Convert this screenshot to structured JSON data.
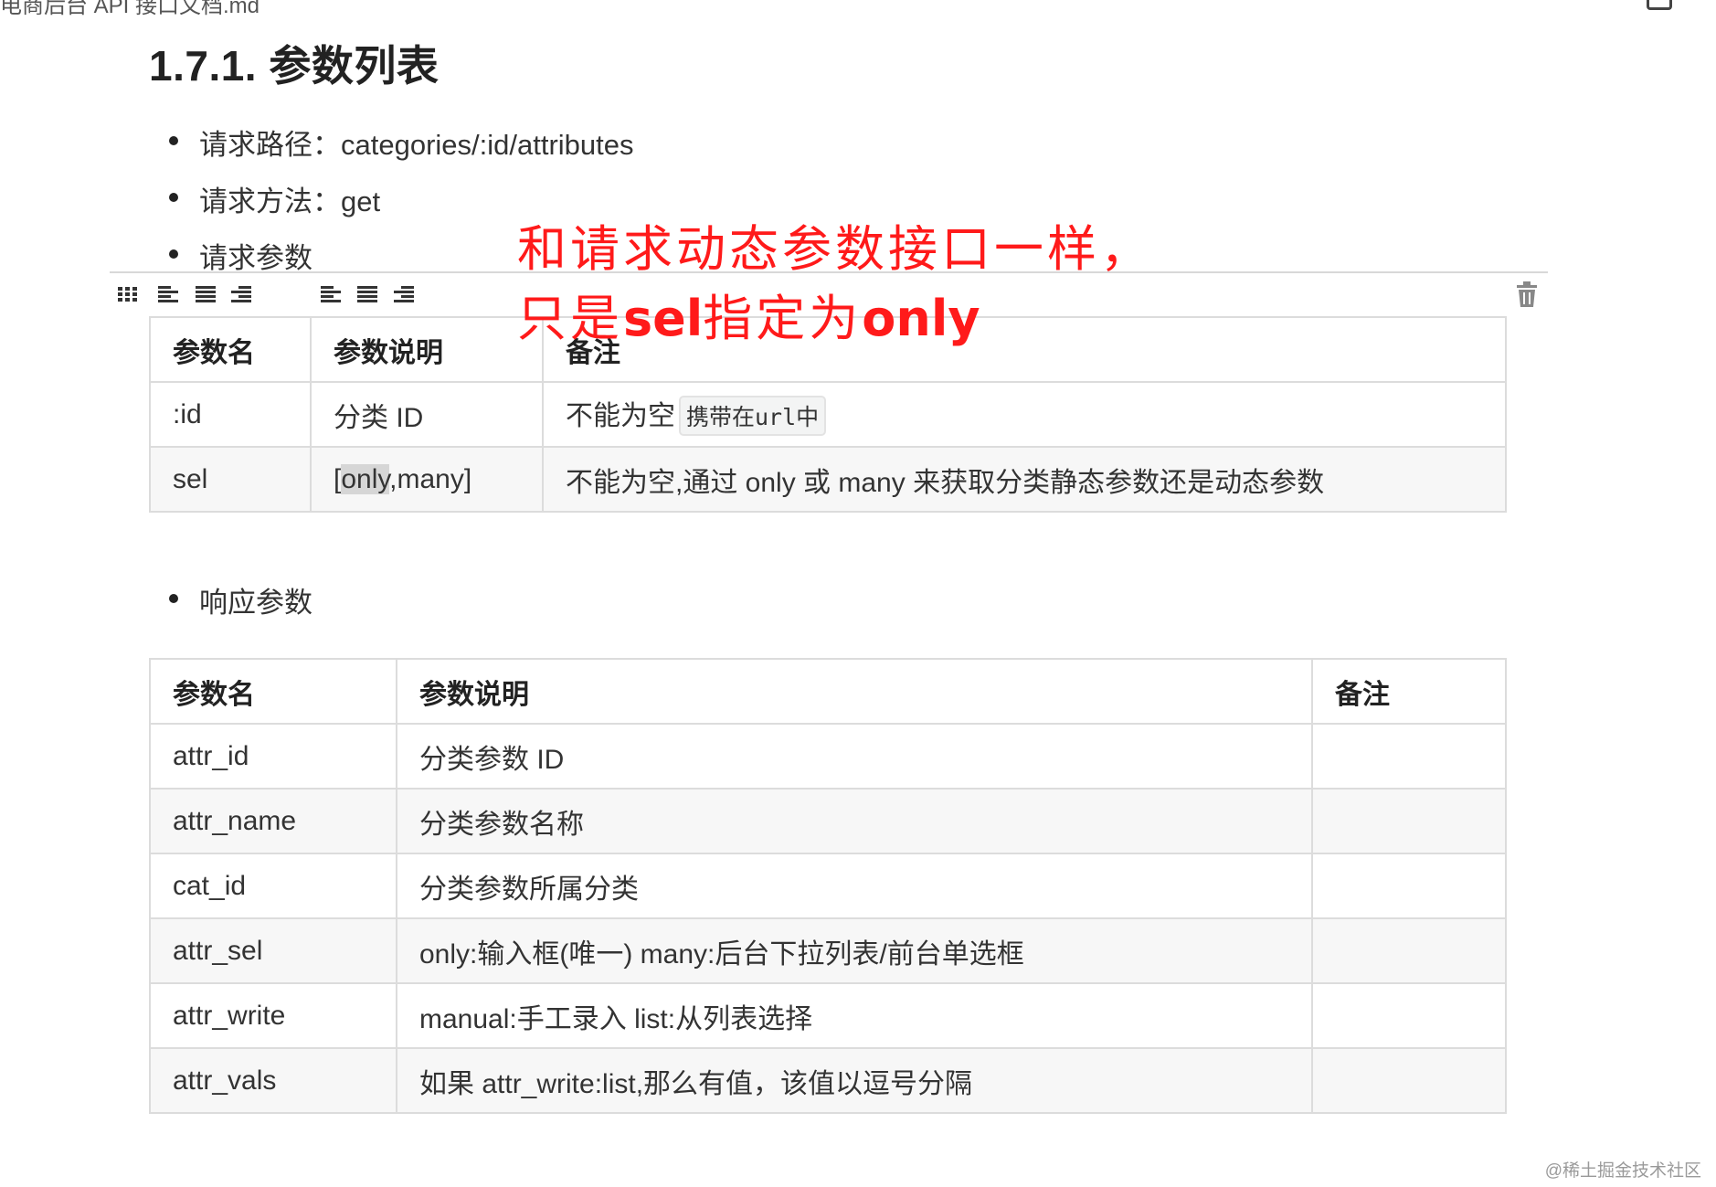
{
  "topbar": {
    "title": "电商后台 API 接口文档.md"
  },
  "heading": "1.7.1. 参数列表",
  "bullets": {
    "path": "请求路径：categories/:id/attributes",
    "method": "请求方法：get",
    "params": "请求参数",
    "response": "响应参数"
  },
  "annotation": {
    "line1": "和请求动态参数接口一样，",
    "line2_prefix": "只是",
    "line2_bold": "sel",
    "line2_middle": "指定为",
    "line2_end": "only"
  },
  "toolbar": {
    "icons": [
      "table-grid-icon",
      "align-left-icon",
      "align-center-icon",
      "align-right-icon",
      "col-align-left-icon",
      "col-align-center-icon",
      "col-align-right-icon",
      "trash-icon"
    ]
  },
  "request_table": {
    "headers": [
      "参数名",
      "参数说明",
      "备注"
    ],
    "rows": [
      {
        "name": ":id",
        "desc": "分类 ID",
        "note": "不能为空",
        "note_code": "携带在url中"
      },
      {
        "name": "sel",
        "desc_pre": "[",
        "desc_hl": "only",
        "desc_post": ",many]",
        "note": "不能为空,通过 only 或 many 来获取分类静态参数还是动态参数"
      }
    ]
  },
  "response_table": {
    "headers": [
      "参数名",
      "参数说明",
      "备注"
    ],
    "rows": [
      {
        "name": "attr_id",
        "desc": "分类参数 ID",
        "note": ""
      },
      {
        "name": "attr_name",
        "desc": "分类参数名称",
        "note": ""
      },
      {
        "name": "cat_id",
        "desc": "分类参数所属分类",
        "note": ""
      },
      {
        "name": "attr_sel",
        "desc": "only:输入框(唯一) many:后台下拉列表/前台单选框",
        "note": ""
      },
      {
        "name": "attr_write",
        "desc": "manual:手工录入 list:从列表选择",
        "note": ""
      },
      {
        "name": "attr_vals",
        "desc": "如果 attr_write:list,那么有值，该值以逗号分隔",
        "note": ""
      }
    ]
  },
  "watermark": "@稀土掘金技术社区"
}
